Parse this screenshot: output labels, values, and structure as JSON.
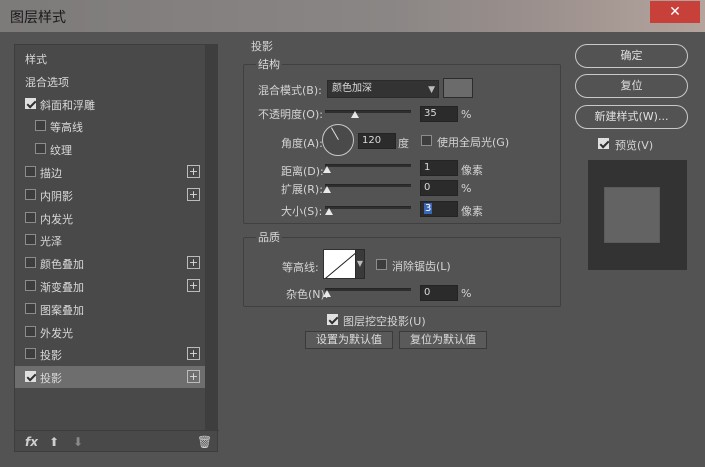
{
  "window": {
    "title": "图层样式",
    "close_glyph": "✕"
  },
  "left_list": {
    "items": [
      {
        "label": "样式",
        "header": true
      },
      {
        "label": "混合选项",
        "header": true
      },
      {
        "label": "斜面和浮雕",
        "checked": true,
        "indent": false,
        "plus": false
      },
      {
        "label": "等高线",
        "checked": false,
        "indent": true,
        "plus": false
      },
      {
        "label": "纹理",
        "checked": false,
        "indent": true,
        "plus": false
      },
      {
        "label": "描边",
        "checked": false,
        "indent": false,
        "plus": true
      },
      {
        "label": "内阴影",
        "checked": false,
        "indent": false,
        "plus": true
      },
      {
        "label": "内发光",
        "checked": false,
        "indent": false,
        "plus": false
      },
      {
        "label": "光泽",
        "checked": false,
        "indent": false,
        "plus": false
      },
      {
        "label": "颜色叠加",
        "checked": false,
        "indent": false,
        "plus": true
      },
      {
        "label": "渐变叠加",
        "checked": false,
        "indent": false,
        "plus": true
      },
      {
        "label": "图案叠加",
        "checked": false,
        "indent": false,
        "plus": false
      },
      {
        "label": "外发光",
        "checked": false,
        "indent": false,
        "plus": false
      },
      {
        "label": "投影",
        "checked": false,
        "indent": false,
        "plus": true
      },
      {
        "label": "投影",
        "checked": true,
        "indent": false,
        "plus": true,
        "selected": true
      }
    ],
    "bottom_icons": {
      "fx": "fx",
      "up": "⬆",
      "down": "⬇",
      "trash": "🗑"
    }
  },
  "section": {
    "title": "投影"
  },
  "structure": {
    "title": "结构",
    "blend_mode_label": "混合模式(B):",
    "blend_mode_value": "颜色加深",
    "opacity_label": "不透明度(O):",
    "opacity_value": "35",
    "opacity_unit": "%",
    "opacity_fraction": 0.35,
    "angle_label": "角度(A):",
    "angle_value": "120",
    "angle_unit": "度",
    "global_light_label": "使用全局光(G)",
    "global_light_checked": false,
    "distance_label": "距离(D):",
    "distance_value": "1",
    "distance_unit": "像素",
    "spread_label": "扩展(R):",
    "spread_value": "0",
    "spread_unit": "%",
    "size_label": "大小(S):",
    "size_value": "3",
    "size_unit": "像素"
  },
  "quality": {
    "title": "品质",
    "contour_label": "等高线:",
    "anti_alias_label": "消除锯齿(L)",
    "anti_alias_checked": false,
    "noise_label": "杂色(N):",
    "noise_value": "0",
    "noise_unit": "%"
  },
  "knockout": {
    "label": "图层挖空投影(U)",
    "checked": true
  },
  "defaults": {
    "set_label": "设置为默认值",
    "reset_label": "复位为默认值"
  },
  "buttons": {
    "ok": "确定",
    "reset": "复位",
    "new_style": "新建样式(W)...",
    "preview_label": "预览(V)",
    "preview_checked": true
  },
  "colors": {
    "panel_bg": "#535353",
    "list_bg": "#494949",
    "selected_row": "#6e6e6e",
    "close_red": "#c7403a"
  }
}
